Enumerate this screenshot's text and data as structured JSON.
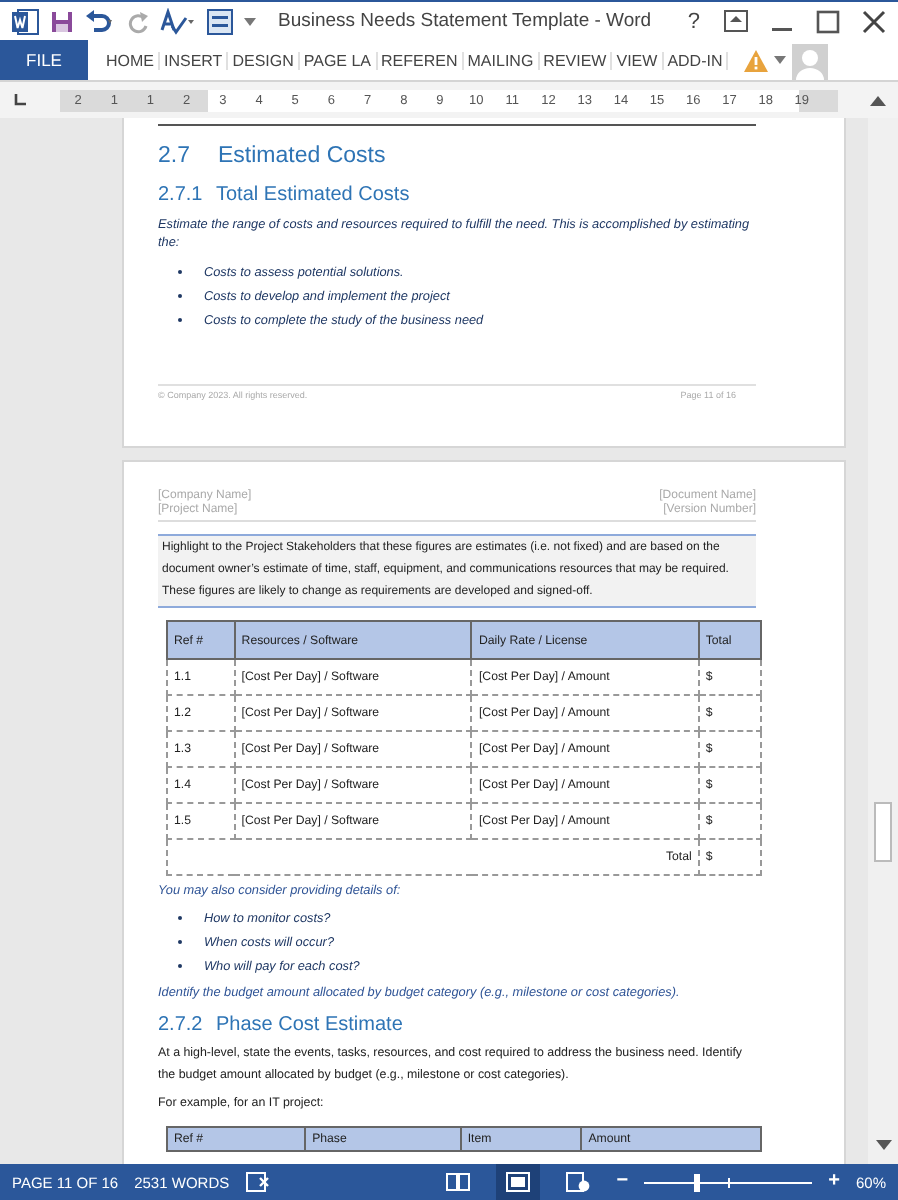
{
  "window": {
    "title": "Business Needs Statement Template - Word",
    "help": "?"
  },
  "ribbon": {
    "file_tab": "FILE",
    "tabs": [
      {
        "label": "HOME",
        "selected": false
      },
      {
        "label": "INSERT",
        "selected": false
      },
      {
        "label": "DESIGN",
        "selected": false
      },
      {
        "label": "PAGE LA",
        "selected": false
      },
      {
        "label": "REFEREN",
        "selected": false
      },
      {
        "label": "MAILING",
        "selected": false
      },
      {
        "label": "REVIEW",
        "selected": false
      },
      {
        "label": "VIEW",
        "selected": false
      },
      {
        "label": "ADD-IN",
        "selected": false
      }
    ]
  },
  "ruler": {
    "labels": [
      "2",
      "1",
      "1",
      "2",
      "3",
      "4",
      "5",
      "6",
      "7",
      "8",
      "9",
      "10",
      "11",
      "12",
      "13",
      "14",
      "15",
      "16",
      "17",
      "18",
      "19"
    ]
  },
  "page_1": {
    "section": {
      "number": "2.7",
      "title": "Estimated Costs"
    },
    "subsection": {
      "number": "2.7.1",
      "title": "Total Estimated Costs"
    },
    "intro": "Estimate the range of costs and resources required to fulfill the need. This is accomplished by estimating the:",
    "bullets": [
      "Costs to assess potential solutions.",
      "Costs to develop and implement the project",
      "Costs to complete the study of the business need"
    ],
    "footer_left": "© Company 2023. All rights reserved.",
    "footer_right": "Page 11 of 16"
  },
  "page_2": {
    "header": {
      "left": [
        "[Company Name]",
        "[Project Name]"
      ],
      "right": [
        "[Document Name]",
        "[Version Number]"
      ]
    },
    "note": "Highlight to the Project Stakeholders that these figures are estimates (i.e. not fixed) and are based on the document owner’s estimate of time, staff, equipment, and communications resources that may be required. These figures are likely to change as requirements are developed and signed-off.",
    "cost_table": {
      "columns": [
        "Ref #",
        "Resources / Software",
        "Daily Rate / License",
        "Total"
      ],
      "rows": [
        [
          "1.1",
          "[Cost Per Day] / Software",
          "[Cost Per Day] / Amount",
          "$"
        ],
        [
          "1.2",
          "[Cost Per Day] / Software",
          "[Cost Per Day] / Amount",
          "$"
        ],
        [
          "1.3",
          "[Cost Per Day] / Software",
          "[Cost Per Day] / Amount",
          "$"
        ],
        [
          "1.4",
          "[Cost Per Day] / Software",
          "[Cost Per Day] / Amount",
          "$"
        ],
        [
          "1.5",
          "[Cost Per Day] / Software",
          "[Cost Per Day] / Amount",
          "$"
        ]
      ],
      "total_label": "Total",
      "total_value": "$"
    },
    "details_intro": "You may also consider providing details of:",
    "details_bullets": [
      "How to monitor costs?",
      "When costs will occur?",
      "Who will pay for each cost?"
    ],
    "details_outro": "Identify the budget amount allocated by budget category (e.g., milestone or cost categories).",
    "subsection": {
      "number": "2.7.2",
      "title": "Phase Cost Estimate"
    },
    "body": "At a high-level, state the events, tasks, resources, and cost required to address the business need. Identify the budget amount allocated by budget (e.g., milestone or cost categories).",
    "example": "For example, for an IT project:",
    "phase_table": {
      "columns": [
        "Ref #",
        "Phase",
        "Item",
        "Amount"
      ]
    }
  },
  "status_bar": {
    "page": "PAGE 11 OF 16",
    "words": "2531 WORDS",
    "views": [
      {
        "kind": "read",
        "selected": false
      },
      {
        "kind": "print",
        "selected": true
      },
      {
        "kind": "web",
        "selected": false
      }
    ],
    "zoom_out": "−",
    "zoom": {
      "level": 0.3
    },
    "zoom_in": "+",
    "zoom_reading": "60%"
  }
}
